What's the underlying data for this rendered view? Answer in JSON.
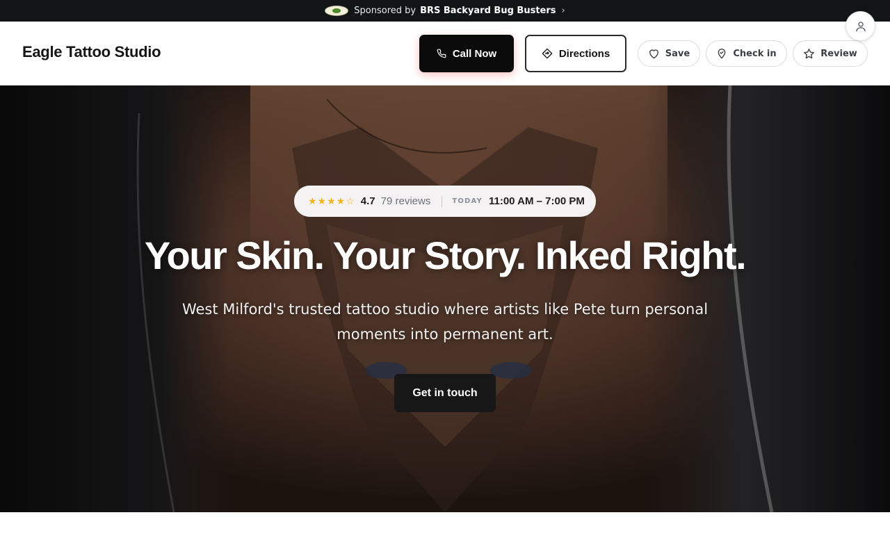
{
  "sponsor": {
    "prefix": "Sponsored by",
    "name": "BRS Backyard Bug Busters",
    "chevron": "›",
    "logo_icon": "sponsor-logo"
  },
  "header": {
    "brand": "Eagle Tattoo Studio",
    "call_label": "Call Now",
    "directions_label": "Directions",
    "save_label": "Save",
    "checkin_label": "Check in",
    "review_label": "Review"
  },
  "hero": {
    "stars": "★★★★☆",
    "rating": "4.7",
    "reviews": "79 reviews",
    "today_label": "TODAY",
    "hours": "11:00 AM – 7:00 PM",
    "title": "Your Skin. Your Story. Inked Right.",
    "subtitle": "West Milford's trusted tattoo studio where artists like Pete turn personal moments into permanent art.",
    "cta_label": "Get in touch"
  },
  "colors": {
    "sponsor_bg": "#111515",
    "accent_dark": "#0b0b0b",
    "star": "#f2b522"
  },
  "icons": [
    "phone-icon",
    "directions-icon",
    "heart-icon",
    "location-pin-icon",
    "star-icon",
    "user-icon"
  ]
}
